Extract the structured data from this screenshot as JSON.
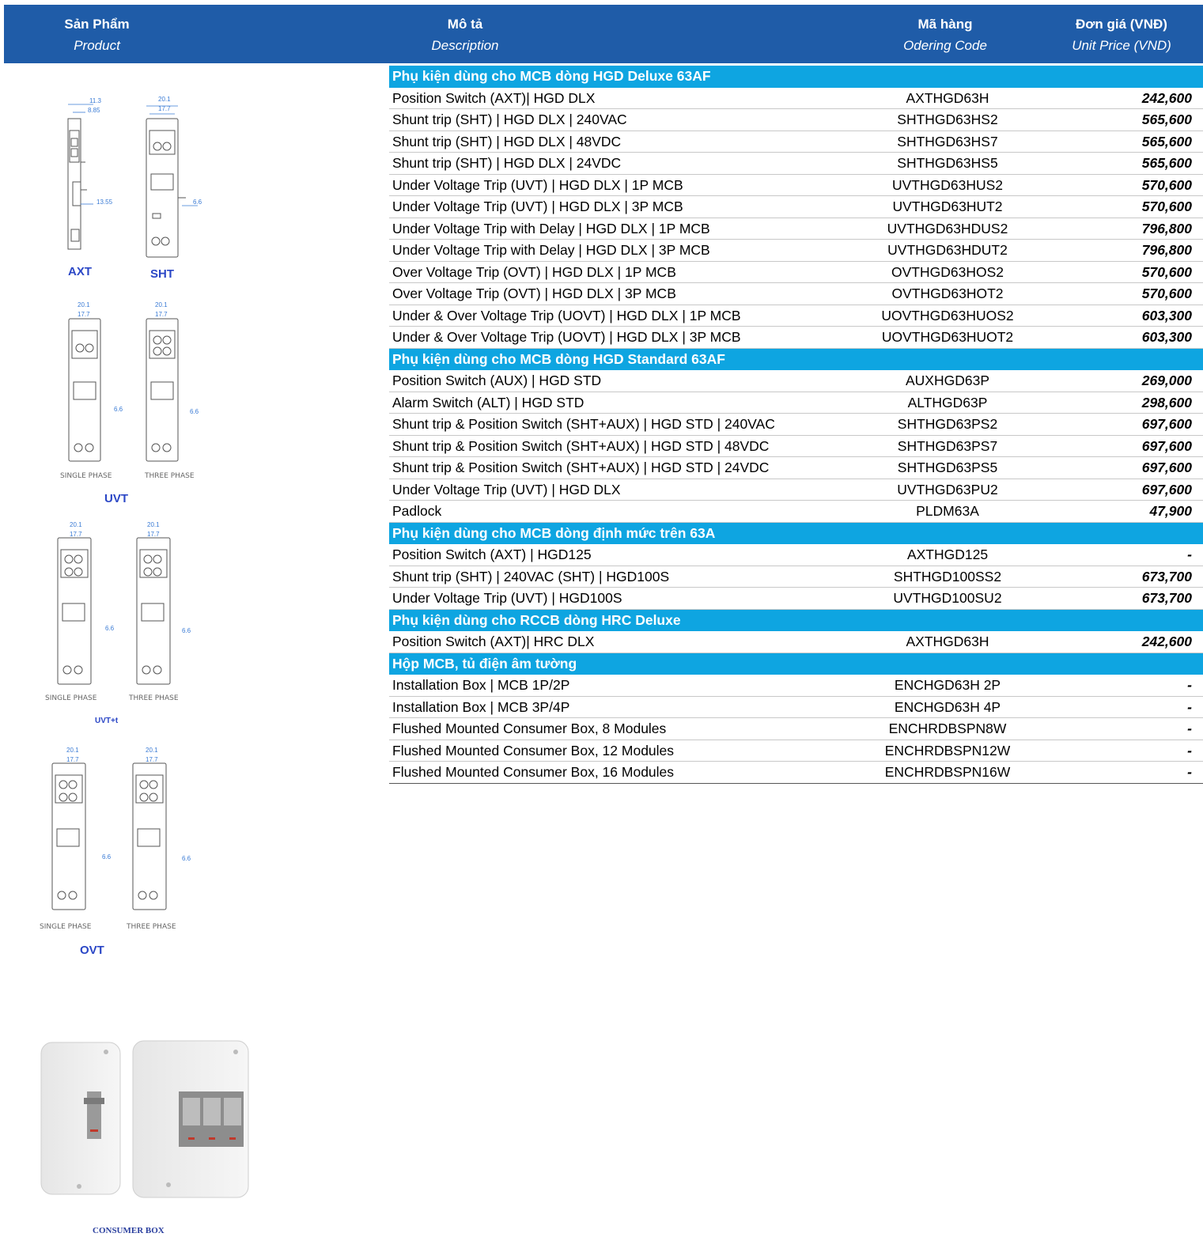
{
  "header": {
    "product_vi": "Sản Phẩm",
    "product_en": "Product",
    "desc_vi": "Mô tả",
    "desc_en": "Description",
    "code_vi": "Mã hàng",
    "code_en": "Odering Code",
    "price_vi": "Đơn giá (VNĐ)",
    "price_en": "Unit Price (VND)"
  },
  "images": {
    "axt": "AXT",
    "sht": "SHT",
    "uvt": "UVT",
    "uvtt": "UVT+t",
    "ovt": "OVT",
    "single_phase": "SINGLE PHASE",
    "three_phase": "THREE PHASE",
    "consumer_box": "CONSUMER BOX",
    "dims": {
      "d1": "11.3",
      "d2": "8.85",
      "d3": "13.55",
      "w1": "20.1",
      "w2": "17.7",
      "s": "6.6"
    }
  },
  "rows": [
    {
      "type": "section",
      "text": "Phụ kiện dùng cho MCB dòng HGD Deluxe 63AF"
    },
    {
      "desc": "Position Switch (AXT)| HGD DLX",
      "code": "AXTHGD63H",
      "price": "242,600"
    },
    {
      "desc": "Shunt trip (SHT) | HGD DLX | 240VAC",
      "code": "SHTHGD63HS2",
      "price": "565,600"
    },
    {
      "desc": "Shunt trip (SHT) | HGD DLX | 48VDC",
      "code": "SHTHGD63HS7",
      "price": "565,600"
    },
    {
      "desc": "Shunt trip (SHT) | HGD DLX | 24VDC",
      "code": "SHTHGD63HS5",
      "price": "565,600"
    },
    {
      "desc": "Under Voltage Trip (UVT) | HGD DLX | 1P MCB",
      "code": "UVTHGD63HUS2",
      "price": "570,600"
    },
    {
      "desc": "Under Voltage Trip (UVT) | HGD DLX | 3P MCB",
      "code": "UVTHGD63HUT2",
      "price": "570,600"
    },
    {
      "desc": "Under Voltage Trip with Delay | HGD DLX | 1P MCB",
      "code": "UVTHGD63HDUS2",
      "price": "796,800"
    },
    {
      "desc": "Under Voltage Trip with Delay | HGD DLX | 3P MCB",
      "code": "UVTHGD63HDUT2",
      "price": "796,800"
    },
    {
      "desc": "Over Voltage Trip (OVT) | HGD DLX | 1P MCB",
      "code": "OVTHGD63HOS2",
      "price": "570,600"
    },
    {
      "desc": "Over Voltage Trip (OVT) | HGD DLX | 3P MCB",
      "code": "OVTHGD63HOT2",
      "price": "570,600"
    },
    {
      "desc": "Under & Over Voltage Trip (UOVT) | HGD DLX | 1P MCB",
      "code": "UOVTHGD63HUOS2",
      "price": "603,300"
    },
    {
      "desc": "Under & Over Voltage Trip (UOVT) | HGD DLX | 3P MCB",
      "code": "UOVTHGD63HUOT2",
      "price": "603,300"
    },
    {
      "type": "section",
      "text": "Phụ kiện dùng cho MCB dòng HGD Standard 63AF"
    },
    {
      "desc": "Position Switch (AUX) | HGD STD",
      "code": "AUXHGD63P",
      "price": "269,000"
    },
    {
      "desc": "Alarm Switch (ALT) | HGD STD",
      "code": "ALTHGD63P",
      "price": "298,600"
    },
    {
      "desc": "Shunt trip & Position Switch (SHT+AUX) | HGD STD | 240VAC",
      "code": "SHTHGD63PS2",
      "price": "697,600"
    },
    {
      "desc": "Shunt trip & Position Switch (SHT+AUX) | HGD STD | 48VDC",
      "code": "SHTHGD63PS7",
      "price": "697,600"
    },
    {
      "desc": "Shunt trip & Position Switch (SHT+AUX) | HGD STD | 24VDC",
      "code": "SHTHGD63PS5",
      "price": "697,600"
    },
    {
      "desc": "Under Voltage Trip (UVT) | HGD DLX",
      "code": "UVTHGD63PU2",
      "price": "697,600"
    },
    {
      "desc": "Padlock",
      "code": "PLDM63A",
      "price": "47,900"
    },
    {
      "type": "section",
      "text": "Phụ kiện dùng cho MCB dòng định mức trên 63A"
    },
    {
      "desc": "Position Switch (AXT) | HGD125",
      "code": "AXTHGD125",
      "price": "-"
    },
    {
      "desc": "Shunt trip (SHT) | 240VAC (SHT) | HGD100S",
      "code": "SHTHGD100SS2",
      "price": "673,700"
    },
    {
      "desc": "Under Voltage Trip (UVT) | HGD100S",
      "code": "UVTHGD100SU2",
      "price": "673,700"
    },
    {
      "type": "section",
      "text": "Phụ kiện dùng cho RCCB dòng HRC Deluxe"
    },
    {
      "desc": "Position Switch (AXT)| HRC DLX",
      "code": "AXTHGD63H",
      "price": "242,600"
    },
    {
      "type": "section",
      "text": "Hộp MCB, tủ điện âm tường"
    },
    {
      "desc": "Installation Box | MCB 1P/2P",
      "code": "ENCHGD63H 2P",
      "price": "-"
    },
    {
      "desc": "Installation Box | MCB 3P/4P",
      "code": "ENCHGD63H 4P",
      "price": "-"
    },
    {
      "desc": "Flushed Mounted Consumer Box, 8 Modules",
      "code": "ENCHRDBSPN8W",
      "price": "-"
    },
    {
      "desc": "Flushed Mounted Consumer Box, 12 Modules",
      "code": "ENCHRDBSPN12W",
      "price": "-"
    },
    {
      "desc": "Flushed Mounted Consumer Box, 16 Modules",
      "code": "ENCHRDBSPN16W",
      "price": "-"
    }
  ]
}
